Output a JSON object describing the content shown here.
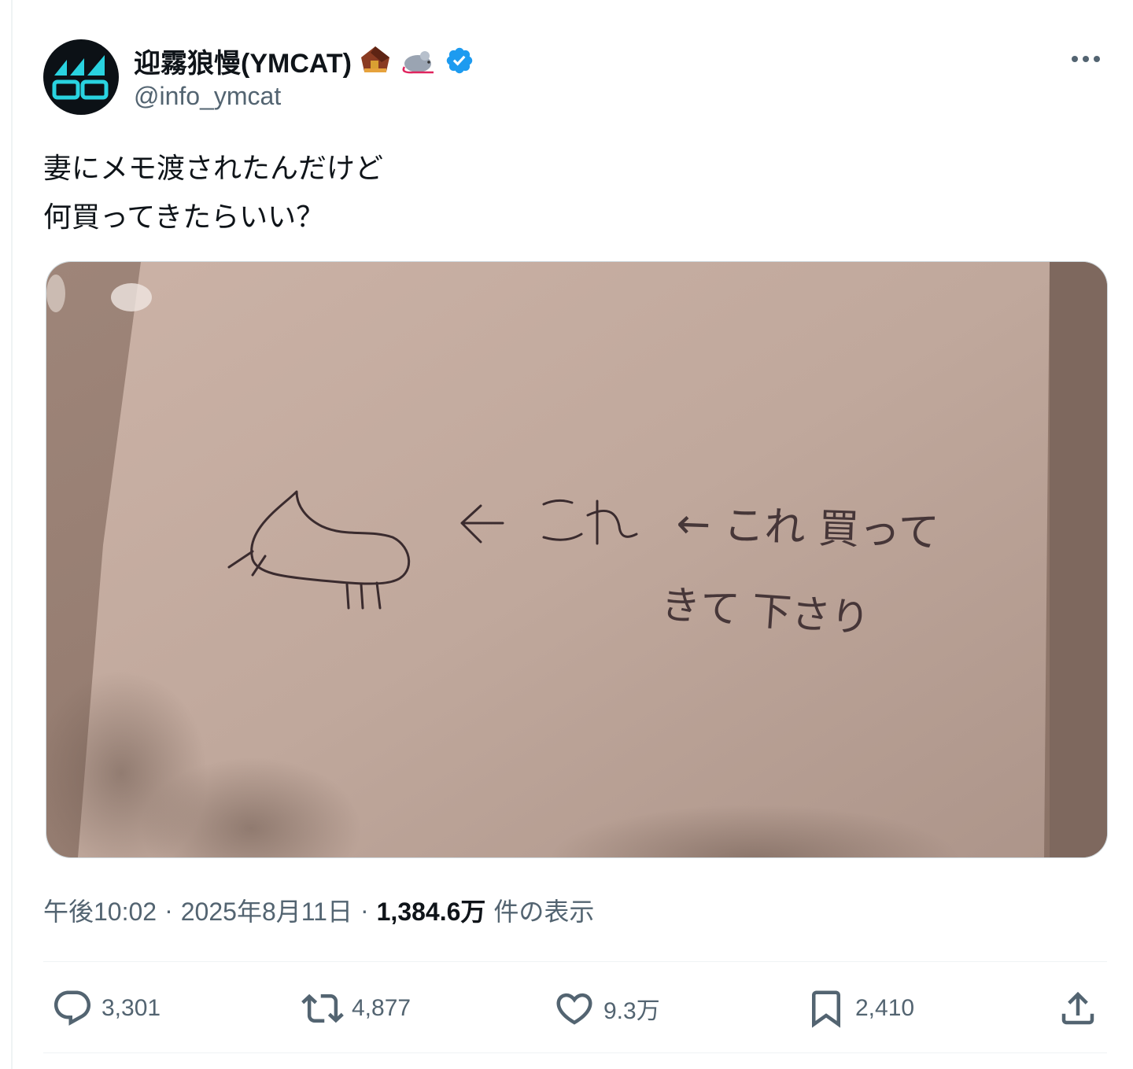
{
  "author": {
    "display_name": "迎霧狼慢(YMCAT)",
    "handle": "@info_ymcat",
    "verified": true,
    "emoji_icons": [
      "house-emoji-icon",
      "mouse-emoji-icon"
    ],
    "verified_color": "#1d9bf0"
  },
  "tweet": {
    "lines": [
      "妻にメモ渡されたんだけど",
      "何買ってきたらいい？"
    ]
  },
  "media": {
    "handwritten_line_1": "← これ 買って",
    "handwritten_line_2": "きて 下さり"
  },
  "meta": {
    "time": "午後10:02",
    "date": "2025年8月11日",
    "views_count": "1,384.6万",
    "views_label": "件の表示",
    "separator": "·"
  },
  "actions": {
    "reply_count": "3,301",
    "repost_count": "4,877",
    "like_count": "9.3万",
    "bookmark_count": "2,410"
  },
  "colors": {
    "text_primary": "#0f1419",
    "text_secondary": "#536471",
    "divider": "#eff3f4",
    "avatar_accent": "#29d3e0"
  }
}
